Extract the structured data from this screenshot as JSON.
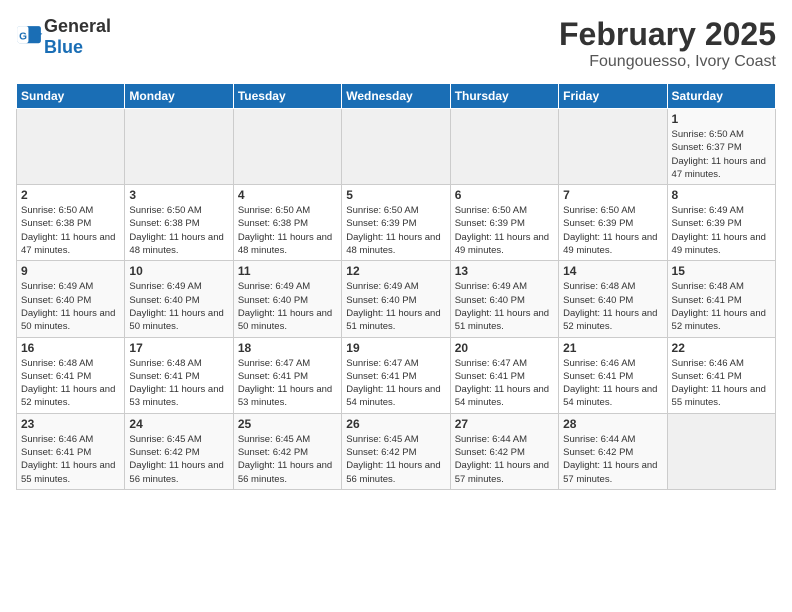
{
  "header": {
    "logo_general": "General",
    "logo_blue": "Blue",
    "month_title": "February 2025",
    "location": "Foungouesso, Ivory Coast"
  },
  "days_of_week": [
    "Sunday",
    "Monday",
    "Tuesday",
    "Wednesday",
    "Thursday",
    "Friday",
    "Saturday"
  ],
  "weeks": [
    [
      {
        "day": "",
        "info": ""
      },
      {
        "day": "",
        "info": ""
      },
      {
        "day": "",
        "info": ""
      },
      {
        "day": "",
        "info": ""
      },
      {
        "day": "",
        "info": ""
      },
      {
        "day": "",
        "info": ""
      },
      {
        "day": "1",
        "info": "Sunrise: 6:50 AM\nSunset: 6:37 PM\nDaylight: 11 hours and 47 minutes."
      }
    ],
    [
      {
        "day": "2",
        "info": "Sunrise: 6:50 AM\nSunset: 6:38 PM\nDaylight: 11 hours and 47 minutes."
      },
      {
        "day": "3",
        "info": "Sunrise: 6:50 AM\nSunset: 6:38 PM\nDaylight: 11 hours and 48 minutes."
      },
      {
        "day": "4",
        "info": "Sunrise: 6:50 AM\nSunset: 6:38 PM\nDaylight: 11 hours and 48 minutes."
      },
      {
        "day": "5",
        "info": "Sunrise: 6:50 AM\nSunset: 6:39 PM\nDaylight: 11 hours and 48 minutes."
      },
      {
        "day": "6",
        "info": "Sunrise: 6:50 AM\nSunset: 6:39 PM\nDaylight: 11 hours and 49 minutes."
      },
      {
        "day": "7",
        "info": "Sunrise: 6:50 AM\nSunset: 6:39 PM\nDaylight: 11 hours and 49 minutes."
      },
      {
        "day": "8",
        "info": "Sunrise: 6:49 AM\nSunset: 6:39 PM\nDaylight: 11 hours and 49 minutes."
      }
    ],
    [
      {
        "day": "9",
        "info": "Sunrise: 6:49 AM\nSunset: 6:40 PM\nDaylight: 11 hours and 50 minutes."
      },
      {
        "day": "10",
        "info": "Sunrise: 6:49 AM\nSunset: 6:40 PM\nDaylight: 11 hours and 50 minutes."
      },
      {
        "day": "11",
        "info": "Sunrise: 6:49 AM\nSunset: 6:40 PM\nDaylight: 11 hours and 50 minutes."
      },
      {
        "day": "12",
        "info": "Sunrise: 6:49 AM\nSunset: 6:40 PM\nDaylight: 11 hours and 51 minutes."
      },
      {
        "day": "13",
        "info": "Sunrise: 6:49 AM\nSunset: 6:40 PM\nDaylight: 11 hours and 51 minutes."
      },
      {
        "day": "14",
        "info": "Sunrise: 6:48 AM\nSunset: 6:40 PM\nDaylight: 11 hours and 52 minutes."
      },
      {
        "day": "15",
        "info": "Sunrise: 6:48 AM\nSunset: 6:41 PM\nDaylight: 11 hours and 52 minutes."
      }
    ],
    [
      {
        "day": "16",
        "info": "Sunrise: 6:48 AM\nSunset: 6:41 PM\nDaylight: 11 hours and 52 minutes."
      },
      {
        "day": "17",
        "info": "Sunrise: 6:48 AM\nSunset: 6:41 PM\nDaylight: 11 hours and 53 minutes."
      },
      {
        "day": "18",
        "info": "Sunrise: 6:47 AM\nSunset: 6:41 PM\nDaylight: 11 hours and 53 minutes."
      },
      {
        "day": "19",
        "info": "Sunrise: 6:47 AM\nSunset: 6:41 PM\nDaylight: 11 hours and 54 minutes."
      },
      {
        "day": "20",
        "info": "Sunrise: 6:47 AM\nSunset: 6:41 PM\nDaylight: 11 hours and 54 minutes."
      },
      {
        "day": "21",
        "info": "Sunrise: 6:46 AM\nSunset: 6:41 PM\nDaylight: 11 hours and 54 minutes."
      },
      {
        "day": "22",
        "info": "Sunrise: 6:46 AM\nSunset: 6:41 PM\nDaylight: 11 hours and 55 minutes."
      }
    ],
    [
      {
        "day": "23",
        "info": "Sunrise: 6:46 AM\nSunset: 6:41 PM\nDaylight: 11 hours and 55 minutes."
      },
      {
        "day": "24",
        "info": "Sunrise: 6:45 AM\nSunset: 6:42 PM\nDaylight: 11 hours and 56 minutes."
      },
      {
        "day": "25",
        "info": "Sunrise: 6:45 AM\nSunset: 6:42 PM\nDaylight: 11 hours and 56 minutes."
      },
      {
        "day": "26",
        "info": "Sunrise: 6:45 AM\nSunset: 6:42 PM\nDaylight: 11 hours and 56 minutes."
      },
      {
        "day": "27",
        "info": "Sunrise: 6:44 AM\nSunset: 6:42 PM\nDaylight: 11 hours and 57 minutes."
      },
      {
        "day": "28",
        "info": "Sunrise: 6:44 AM\nSunset: 6:42 PM\nDaylight: 11 hours and 57 minutes."
      },
      {
        "day": "",
        "info": ""
      }
    ]
  ]
}
